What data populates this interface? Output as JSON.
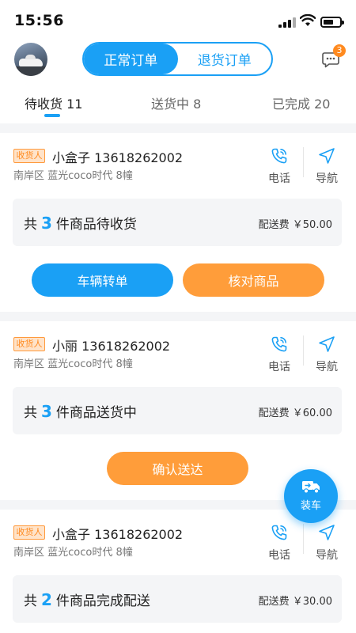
{
  "status_bar": {
    "time": "15:56"
  },
  "header": {
    "segments": [
      {
        "label": "正常订单",
        "active": true
      },
      {
        "label": "退货订单",
        "active": false
      }
    ],
    "message_badge": "3"
  },
  "tabs": [
    {
      "label": "待收货",
      "count": "11",
      "active": true
    },
    {
      "label": "送货中",
      "count": "8",
      "active": false
    },
    {
      "label": "已完成",
      "count": "20",
      "active": false
    }
  ],
  "actions": {
    "call": "电话",
    "navigate": "导航"
  },
  "orders": [
    {
      "tag": "收货人",
      "name": "小盒子",
      "phone": "13618262002",
      "address": "南岸区 蓝光coco时代 8幢",
      "summary_prefix": "共",
      "count": "3",
      "summary_suffix": "件商品待收货",
      "fee": "配送费 ￥50.00",
      "buttons": [
        "车辆转单",
        "核对商品"
      ]
    },
    {
      "tag": "收货人",
      "name": "小丽",
      "phone": "13618262002",
      "address": "南岸区 蓝光coco时代 8幢",
      "summary_prefix": "共",
      "count": "3",
      "summary_suffix": "件商品送货中",
      "fee": "配送费 ￥60.00",
      "buttons": [
        "确认送达"
      ]
    },
    {
      "tag": "收货人",
      "name": "小盒子",
      "phone": "13618262002",
      "address": "南岸区 蓝光coco时代 8幢",
      "summary_prefix": "共",
      "count": "2",
      "summary_suffix": "件商品完成配送",
      "fee": "配送费 ￥30.00",
      "buttons": []
    }
  ],
  "fab": {
    "label": "装车",
    "icon": "truck-icon"
  },
  "colors": {
    "accent": "#1aa0f5",
    "orange": "#ff9d3a",
    "tag_bg": "#ffe3c9"
  }
}
